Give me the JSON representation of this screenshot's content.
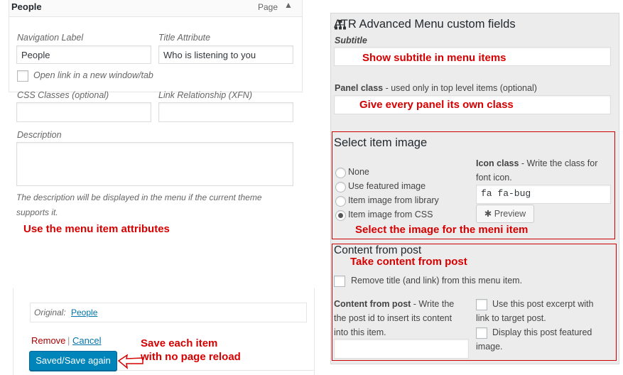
{
  "menu_item": {
    "title": "People",
    "type": "Page",
    "navigation_label": {
      "label": "Navigation Label",
      "value": "People"
    },
    "title_attribute": {
      "label": "Title Attribute",
      "value": "Who is listening to you"
    },
    "open_new_tab": "Open link in a new window/tab",
    "css_classes": {
      "label": "CSS Classes (optional)",
      "value": ""
    },
    "link_relationship": {
      "label": "Link Relationship (XFN)",
      "value": ""
    },
    "description": {
      "label": "Description",
      "value": "",
      "hint_line1": "The description will be displayed in the menu if the current theme",
      "hint_line2": "supports it."
    },
    "original_label": "Original:",
    "original_link": "People",
    "remove": "Remove",
    "separator": "|",
    "cancel": "Cancel",
    "save_button": "Saved/Save again"
  },
  "annotations": {
    "menu_attributes": "Use the menu item attributes",
    "save_line1": "Save each item",
    "save_line2": "with no page reload",
    "subtitle": "Show subtitle in menu items",
    "panel_class": "Give every panel its own class",
    "select_image": "Select the image for the meni item",
    "content": "Take content from post"
  },
  "atr_panel": {
    "title": "ATR Advanced Menu custom fields",
    "icon": "sitemap-icon",
    "subtitle_label": "Subtitle",
    "panel_class_label": "Panel class",
    "panel_class_hint": " - used only in top level items (optional)",
    "select_image_heading": "Select item image",
    "image_options": [
      "None",
      "Use featured image",
      "Item image from library",
      "Item image from CSS"
    ],
    "selected_option": "Item image from CSS",
    "icon_class_label": "Icon class",
    "icon_class_hint_1": " - Write the class for",
    "icon_class_hint_2": "font icon.",
    "icon_class_value": "fa fa-bug",
    "preview_button": "Preview",
    "content_heading": "Content from post",
    "remove_title_label": "Remove title (and link) from this menu item.",
    "content_from_post_label": "Content from post",
    "content_hint_1": " - Write the",
    "content_hint_2": "the post id to insert its content",
    "content_hint_3": "into this item.",
    "excerpt_label_1": "Use this post excerpt with",
    "excerpt_label_2": "link to target post.",
    "featured_label_1": "Display this post featured",
    "featured_label_2": "image.",
    "content_post_id": ""
  },
  "colors": {
    "annotation_red": "#d60000",
    "wp_button_blue": "#0085ba",
    "link_blue": "#0073aa",
    "remove_red": "#aa0000",
    "panel_gray": "#ececec"
  }
}
